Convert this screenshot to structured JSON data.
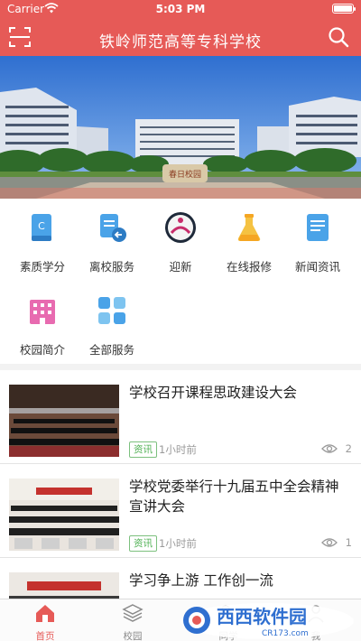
{
  "status_bar": {
    "carrier": "Carrier",
    "time": "5:03 PM",
    "battery_level": 1.0
  },
  "header": {
    "title": "铁岭师范高等专科学校",
    "left_icon": "scan-icon",
    "right_icon": "search-icon"
  },
  "banner": {
    "image": "campus-building-photo",
    "stone_text": "春日校园"
  },
  "services": [
    {
      "label": "素质学分",
      "icon": "book-icon"
    },
    {
      "label": "离校服务",
      "icon": "document-arrow-icon"
    },
    {
      "label": "迎新",
      "icon": "welcome-badge-icon"
    },
    {
      "label": "在线报修",
      "icon": "flask-icon"
    },
    {
      "label": "新闻资讯",
      "icon": "news-icon"
    },
    {
      "label": "校园简介",
      "icon": "building-icon"
    },
    {
      "label": "全部服务",
      "icon": "grid-icon"
    }
  ],
  "news": [
    {
      "title": "学校召开课程思政建设大会",
      "tag": "资讯",
      "time": "1小时前",
      "views": "2"
    },
    {
      "title": "学校党委举行十九届五中全会精神宣讲大会",
      "tag": "资讯",
      "time": "1小时前",
      "views": "1"
    },
    {
      "title": "学习争上游 工作创一流",
      "tag": "",
      "time": "",
      "views": ""
    }
  ],
  "tabs": [
    {
      "label": "首页",
      "icon": "home-icon",
      "active": true
    },
    {
      "label": "校园",
      "icon": "layers-icon",
      "active": false
    },
    {
      "label": "同学",
      "icon": "people-icon",
      "active": false
    },
    {
      "label": "我",
      "icon": "person-icon",
      "active": false
    }
  ],
  "watermark": {
    "text": "西西软件园",
    "url": "CR173.com"
  },
  "colors": {
    "primary": "#e65a57",
    "tag_green": "#4caf50",
    "grid_blue": "#4aa3e8",
    "grid_pink": "#e86bb0",
    "grid_orange": "#f5a623"
  }
}
